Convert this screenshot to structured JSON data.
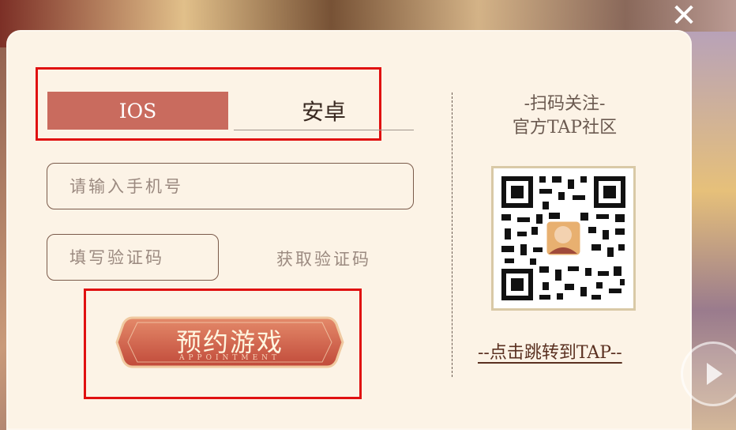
{
  "tabs": [
    {
      "label": "IOS",
      "active": true
    },
    {
      "label": "安卓",
      "active": false
    }
  ],
  "form": {
    "phone_placeholder": "请输入手机号",
    "code_placeholder": "填写验证码",
    "get_code_label": "获取验证码"
  },
  "appointment": {
    "label": "预约游戏",
    "sublabel": "APPOINTMENT"
  },
  "qr": {
    "title_line1": "-扫码关注-",
    "title_line2": "官方TAP社区",
    "link_label": "--点击跳转到TAP--"
  },
  "icons": {
    "close": "close-icon",
    "play": "play-icon",
    "qr": "qr-code-icon"
  },
  "colors": {
    "accent": "#c96b5e",
    "panel": "#fcf3e6",
    "highlight_box": "#e01010"
  }
}
